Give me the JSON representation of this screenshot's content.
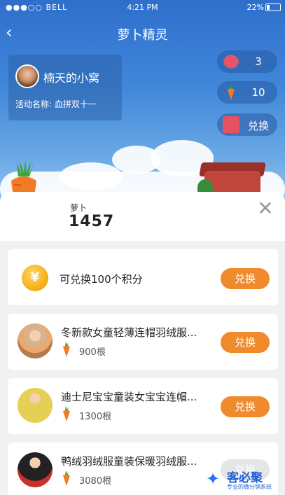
{
  "status_bar": {
    "carrier": "●●●○○ BELL",
    "time": "4:21 PM",
    "battery": "22%"
  },
  "nav": {
    "title": "萝卜精灵"
  },
  "user": {
    "name": "楠天的小窝",
    "activity_label": "活动名称: ",
    "activity_name": "血拼双十一"
  },
  "pills": [
    {
      "icon": "heart-icon",
      "value": "3"
    },
    {
      "icon": "carrot-icon",
      "value": "10"
    },
    {
      "icon": "gift-icon",
      "value": "兑换"
    }
  ],
  "sheet": {
    "label": "萝卜",
    "value": "1457"
  },
  "coin_row": {
    "coin_symbol": "¥",
    "title": "可兑换100个积分",
    "button": "兑换"
  },
  "products": [
    {
      "name": "冬新款女童轻薄连帽羽绒服...",
      "count": "900根",
      "button": "兑换",
      "enabled": true
    },
    {
      "name": "迪士尼宝宝童装女宝宝连帽...",
      "count": "1300根",
      "button": "兑换",
      "enabled": true
    },
    {
      "name": "鸭绒羽绒服童装保暖羽绒服...",
      "count": "3080根",
      "button": "兑换",
      "enabled": false
    }
  ],
  "watermark": {
    "title": "客必聚",
    "subtitle": "专业的微分销系统"
  },
  "colors": {
    "accent": "#f18a2a",
    "sky": "#3f86d9"
  }
}
